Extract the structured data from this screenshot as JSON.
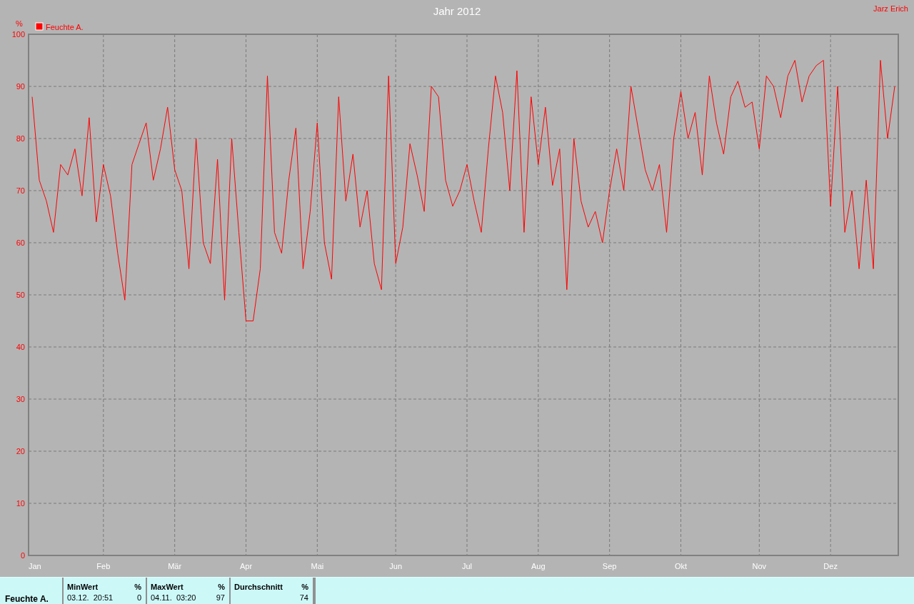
{
  "author": "Jarz Erich",
  "chart": {
    "chart_data": {
      "type": "line",
      "grid": true,
      "title": "Jahr 2012",
      "ylabel": "%",
      "ylim": [
        0,
        100
      ],
      "yticks": [
        0,
        10,
        20,
        30,
        40,
        50,
        60,
        70,
        80,
        90,
        100
      ],
      "categories": [
        "Jan",
        null,
        null,
        null,
        null,
        null,
        null,
        null,
        null,
        null,
        "Feb",
        null,
        null,
        null,
        null,
        null,
        null,
        null,
        null,
        null,
        "Mär",
        null,
        null,
        null,
        null,
        null,
        null,
        null,
        null,
        null,
        "Apr",
        null,
        null,
        null,
        null,
        null,
        null,
        null,
        null,
        null,
        "Mai",
        null,
        null,
        null,
        null,
        null,
        null,
        null,
        null,
        null,
        null,
        "Jun",
        null,
        null,
        null,
        null,
        null,
        null,
        null,
        null,
        null,
        "Jul",
        null,
        null,
        null,
        null,
        null,
        null,
        null,
        null,
        null,
        "Aug",
        null,
        null,
        null,
        null,
        null,
        null,
        null,
        null,
        null,
        "Sep",
        null,
        null,
        null,
        null,
        null,
        null,
        null,
        null,
        null,
        "Okt",
        null,
        null,
        null,
        null,
        null,
        null,
        null,
        null,
        null,
        null,
        "Nov",
        null,
        null,
        null,
        null,
        null,
        null,
        null,
        null,
        null,
        "Dez",
        null,
        null,
        null,
        null,
        null,
        null,
        null,
        null,
        null
      ],
      "series": [
        {
          "name": "Feuchte A.",
          "color": "#ff0000",
          "values": [
            88,
            72,
            68,
            62,
            75,
            73,
            78,
            69,
            84,
            64,
            75,
            69,
            58,
            49,
            75,
            79,
            83,
            72,
            78,
            86,
            74,
            70,
            55,
            80,
            60,
            56,
            76,
            49,
            80,
            62,
            45,
            45,
            55,
            92,
            62,
            58,
            72,
            82,
            55,
            66,
            83,
            60,
            53,
            88,
            68,
            77,
            63,
            70,
            56,
            51,
            92,
            56,
            63,
            79,
            73,
            66,
            90,
            88,
            72,
            67,
            70,
            75,
            68,
            62,
            78,
            92,
            85,
            70,
            93,
            62,
            88,
            75,
            86,
            71,
            78,
            51,
            80,
            68,
            63,
            66,
            60,
            70,
            78,
            70,
            90,
            82,
            74,
            70,
            75,
            62,
            80,
            89,
            80,
            85,
            73,
            92,
            83,
            77,
            88,
            91,
            86,
            87,
            78,
            92,
            90,
            84,
            92,
            95,
            87,
            92,
            94,
            95,
            67,
            90,
            62,
            70,
            55,
            72,
            55,
            95,
            80,
            90
          ]
        }
      ]
    }
  },
  "summary": {
    "row_label": "Feuchte A.",
    "stats": [
      {
        "name": "MinWert",
        "unit": "%",
        "time": "03.12.  20:51",
        "value": "0"
      },
      {
        "name": "MaxWert",
        "unit": "%",
        "time": "04.11.  03:20",
        "value": "97"
      },
      {
        "name": "Durchschnitt",
        "unit": "%",
        "value": "74"
      }
    ]
  }
}
